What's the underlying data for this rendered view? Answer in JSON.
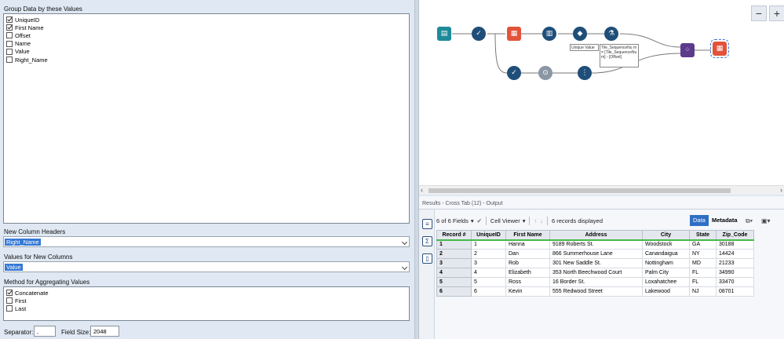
{
  "config": {
    "group_label": "Group Data by these Values",
    "group_fields": [
      {
        "label": "UniqueID",
        "checked": true
      },
      {
        "label": "First Name",
        "checked": true
      },
      {
        "label": "Offset",
        "checked": false
      },
      {
        "label": "Name",
        "checked": false
      },
      {
        "label": "Value",
        "checked": false
      },
      {
        "label": "Right_Name",
        "checked": false
      }
    ],
    "headers_label": "New Column Headers",
    "headers_value": "Right_Name",
    "values_label": "Values for New Columns",
    "values_value": "Value",
    "method_label": "Method for Aggregating Values",
    "methods": [
      {
        "label": "Concatenate",
        "checked": true
      },
      {
        "label": "First",
        "checked": false
      },
      {
        "label": "Last",
        "checked": false
      }
    ],
    "separator_label": "Separator:",
    "separator_value": ",",
    "field_size_label": "Field Size:",
    "field_size_value": "2048"
  },
  "canvas": {
    "zoom_out": "−",
    "zoom_in": "+",
    "annotation_unique": "Unique Value",
    "annotation_formula": "Tile_SequenceNu m = [Tile_SequenceNu m] - [Offset]"
  },
  "results": {
    "title": "Results - Cross Tab (12) - Output",
    "fields": "6 of 6 Fields",
    "cell_viewer": "Cell Viewer",
    "records": "6 records displayed",
    "data_tab": "Data",
    "metadata_tab": "Metadata",
    "columns": [
      "Record #",
      "UniqueID",
      "First Name",
      "Address",
      "City",
      "State",
      "Zip_Code"
    ],
    "rows": [
      [
        "1",
        "1",
        "Hanna",
        "9189 Roberts St.",
        "Woodstock",
        "GA",
        "30188"
      ],
      [
        "2",
        "2",
        "Dan",
        "866 Summerhouse Lane",
        "Canandaigua",
        "NY",
        "14424"
      ],
      [
        "3",
        "3",
        "Rob",
        "301 New Saddle St.",
        "Nottingham",
        "MD",
        "21233"
      ],
      [
        "4",
        "4",
        "Elizabeth",
        "353 North Beechwood Court",
        "Palm City",
        "FL",
        "34990"
      ],
      [
        "5",
        "5",
        "Ross",
        "16 Border St.",
        "Loxahatchee",
        "FL",
        "33470"
      ],
      [
        "6",
        "6",
        "Kevin",
        "555 Redwood Street",
        "Lakewood",
        "NJ",
        "08701"
      ]
    ]
  },
  "colors": {
    "accent": "#3578d6",
    "tool_blue": "#1f4e79",
    "tool_teal": "#1e8a9a",
    "tool_red": "#e2533a",
    "tool_purple": "#5c3a8c",
    "green": "#46b84a"
  }
}
